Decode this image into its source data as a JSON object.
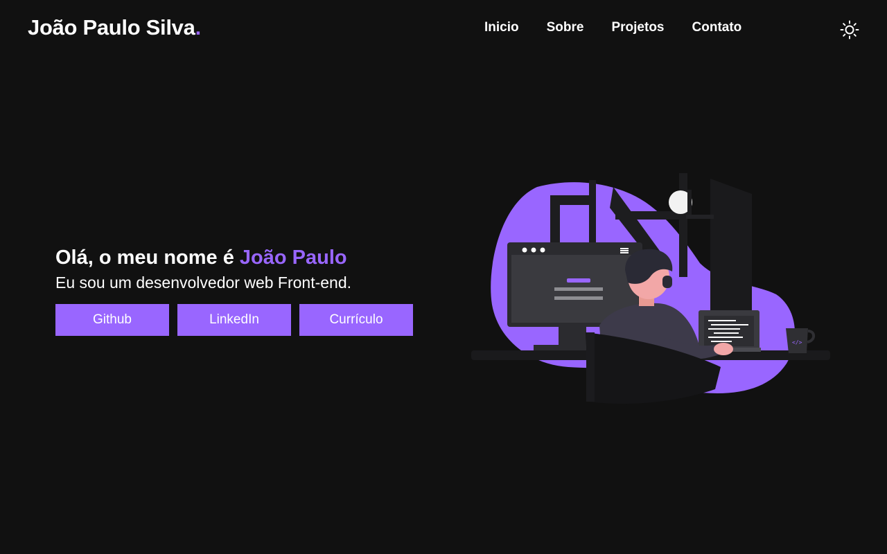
{
  "header": {
    "logo_text": "João Paulo Silva",
    "logo_dot": ".",
    "nav": [
      "Inicio",
      "Sobre",
      "Projetos",
      "Contato"
    ],
    "theme_icon": "sun-icon"
  },
  "hero": {
    "greeting": "Olá, o meu nome é ",
    "name": "João Paulo",
    "subtitle": "Eu sou um desenvolvedor web Front-end.",
    "buttons": [
      "Github",
      "LinkedIn",
      "Currículo"
    ]
  },
  "colors": {
    "background": "#111111",
    "accent": "#9966ff",
    "text": "#ffffff"
  }
}
